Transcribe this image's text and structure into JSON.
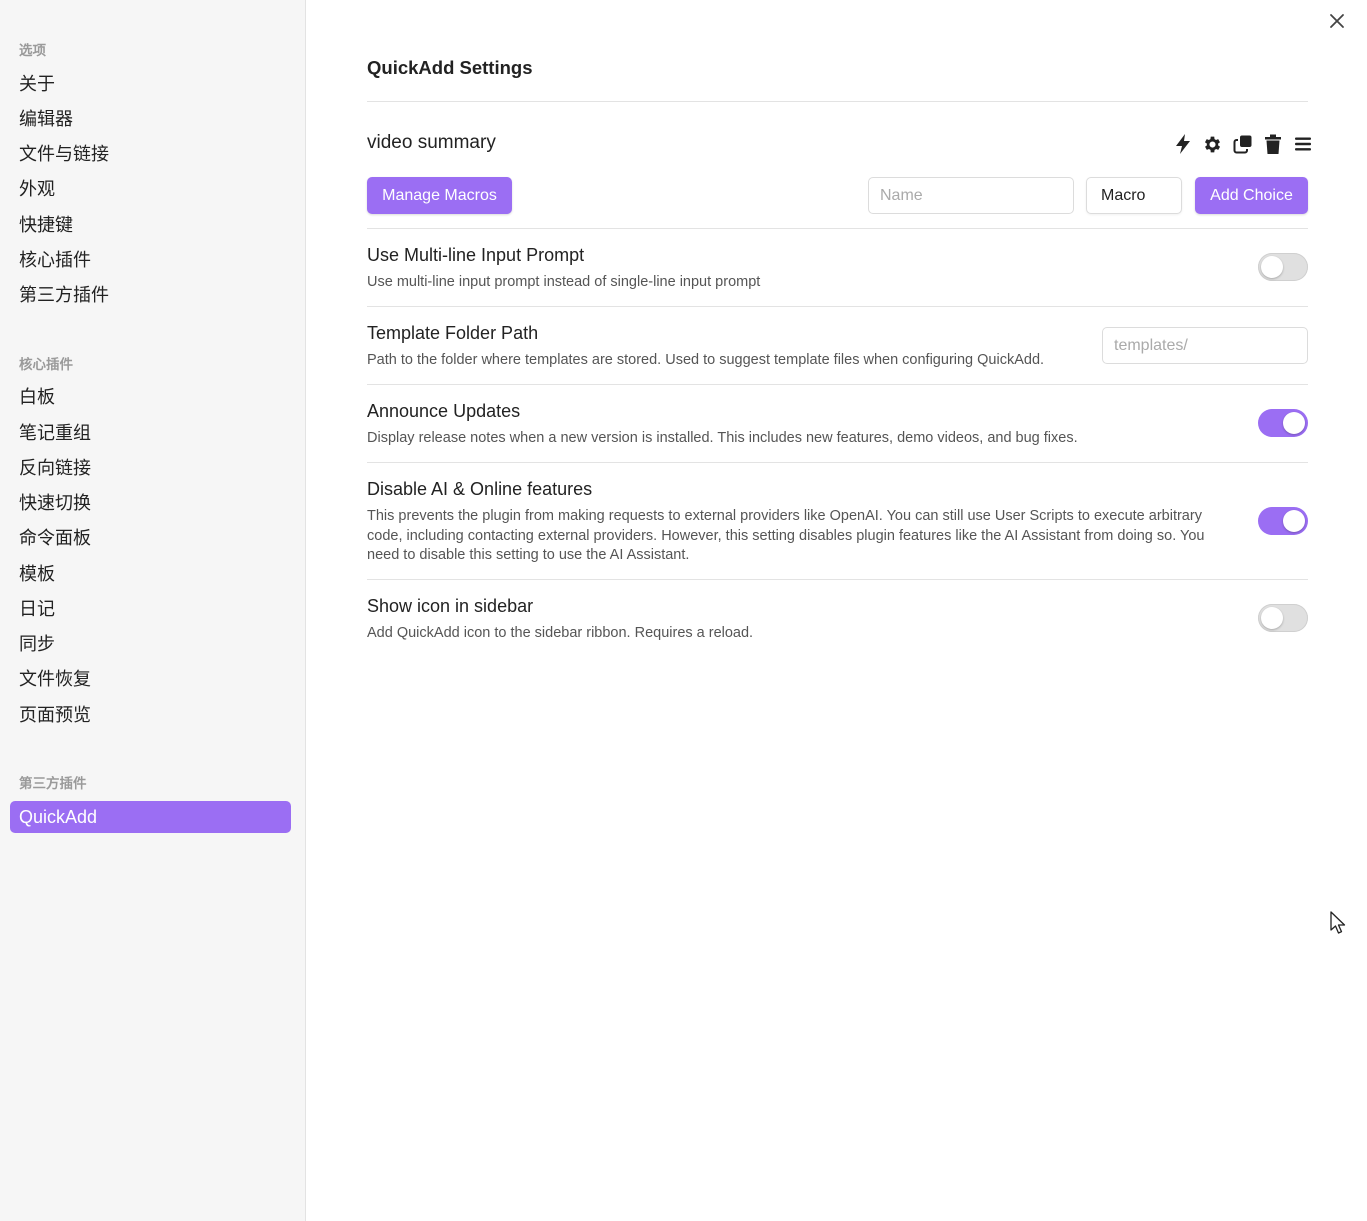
{
  "sidebar": {
    "options_title": "选项",
    "options_items": [
      "关于",
      "编辑器",
      "文件与链接",
      "外观",
      "快捷键",
      "核心插件",
      "第三方插件"
    ],
    "core_plugins_title": "核心插件",
    "core_plugins_items": [
      "白板",
      "笔记重组",
      "反向链接",
      "快速切换",
      "命令面板",
      "模板",
      "日记",
      "同步",
      "文件恢复",
      "页面预览"
    ],
    "community_plugins_title": "第三方插件",
    "community_plugins_items": [
      "QuickAdd"
    ]
  },
  "main": {
    "heading": "QuickAdd Settings",
    "choice": {
      "name": "video summary",
      "icons": [
        "lightning-icon",
        "gear-icon",
        "duplicate-icon",
        "trash-icon",
        "drag-handle-icon"
      ]
    },
    "manage_macros_label": "Manage Macros",
    "name_input": {
      "placeholder": "Name",
      "value": ""
    },
    "type_select": {
      "value": "Macro"
    },
    "add_choice_label": "Add Choice",
    "settings": [
      {
        "name": "Use Multi-line Input Prompt",
        "desc": "Use multi-line input prompt instead of single-line input prompt",
        "control": "toggle",
        "on": false
      },
      {
        "name": "Template Folder Path",
        "desc": "Path to the folder where templates are stored. Used to suggest template files when configuring QuickAdd.",
        "control": "text",
        "placeholder": "templates/"
      },
      {
        "name": "Announce Updates",
        "desc": "Display release notes when a new version is installed. This includes new features, demo videos, and bug fixes.",
        "control": "toggle",
        "on": true
      },
      {
        "name": "Disable AI & Online features",
        "desc": "This prevents the plugin from making requests to external providers like OpenAI. You can still use User Scripts to execute arbitrary code, including contacting external providers. However, this setting disables plugin features like the AI Assistant from doing so. You need to disable this setting to use the AI Assistant.",
        "control": "toggle",
        "on": true
      },
      {
        "name": "Show icon in sidebar",
        "desc": "Add QuickAdd icon to the sidebar ribbon. Requires a reload.",
        "control": "toggle",
        "on": false
      }
    ]
  },
  "colors": {
    "accent": "#9b6ef3",
    "sidebar_bg": "#f6f6f6",
    "toggle_off": "#e0e0e0"
  }
}
